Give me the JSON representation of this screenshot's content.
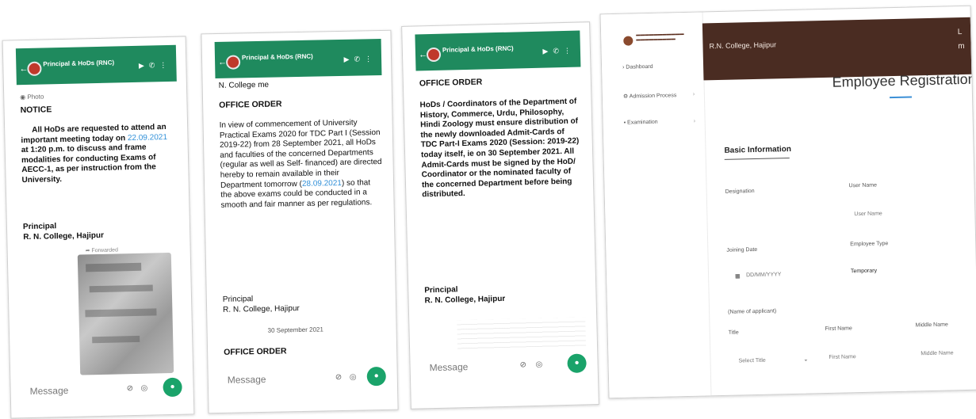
{
  "colors": {
    "chat_header": "#1f8a5e",
    "mic": "#1aa36a",
    "link": "#2f8fd8",
    "web_topbar": "#4a2c22",
    "accent": "#3b8fd6"
  },
  "chat": {
    "group_title": "Principal & HoDs (RNC)",
    "input_placeholder": "Message"
  },
  "panel1": {
    "photo_label": "Photo",
    "notice_heading": "NOTICE",
    "notice_parts": [
      "All HoDs are requested to attend an important meeting today on ",
      "22.09.2021",
      " at 1:20 p.m. to discuss and frame modalities for conducting Exams of AECC-1, as per instruction from the University."
    ],
    "signature_title": "Principal",
    "signature_college": "R. N. College, Hajipur",
    "forwarded": "Forwarded"
  },
  "panel2": {
    "top_line": "N. College me",
    "heading": "OFFICE ORDER",
    "body_parts": [
      "In view of commencement of University Practical Exams 2020 for TDC Part I (Session 2019-22) from 28 September 2021, all HoDs and faculties of the concerned Departments (regular as well as Self- financed) are directed hereby to remain available in their Department tomorrow (",
      "28.09.2021",
      ") so that the above exams could be conducted in a smooth and fair manner as per regulations."
    ],
    "signature_title": "Principal",
    "signature_college": "R. N. College, Hajipur",
    "date_divider": "30 September 2021",
    "heading2": "OFFICE ORDER"
  },
  "panel3": {
    "heading": "OFFICE ORDER",
    "body": "HoDs / Coordinators of the Department of History, Commerce, Urdu, Philosophy, Hindi Zoology must ensure distribution of the newly downloaded Admit-Cards of TDC Part-I Exams 2020 (Session: 2019-22) today itself, ie on 30 September 2021. All Admit-Cards must be signed by the HoD/ Coordinator or the nominated faculty of the concerned Department before being distributed.",
    "signature_title": "Principal",
    "signature_college": "R. N. College, Hajipur"
  },
  "web": {
    "college": "R.N. College, Hajipur",
    "form_title": "Employee Registration Fo",
    "sidebar": [
      {
        "label": "Dashboard"
      },
      {
        "label": "Admission Process"
      },
      {
        "label": "Examination"
      }
    ],
    "section": "Basic Information",
    "labels": {
      "designation": "Designation",
      "user_name": "User Name",
      "joining_date": "Joining Date",
      "employee_type": "Employee Type",
      "name_of_applicant": "(Name of applicant)",
      "title": "Title",
      "first_name": "First Name",
      "middle_name": "Middle Name"
    },
    "values": {
      "user_name_placeholder": "User Name",
      "date_placeholder": "DD/MM/YYYY",
      "employee_type": "Temporary",
      "select_title": "Select Title",
      "first_name_placeholder": "First Name",
      "middle_name_placeholder": "Middle Name"
    }
  }
}
